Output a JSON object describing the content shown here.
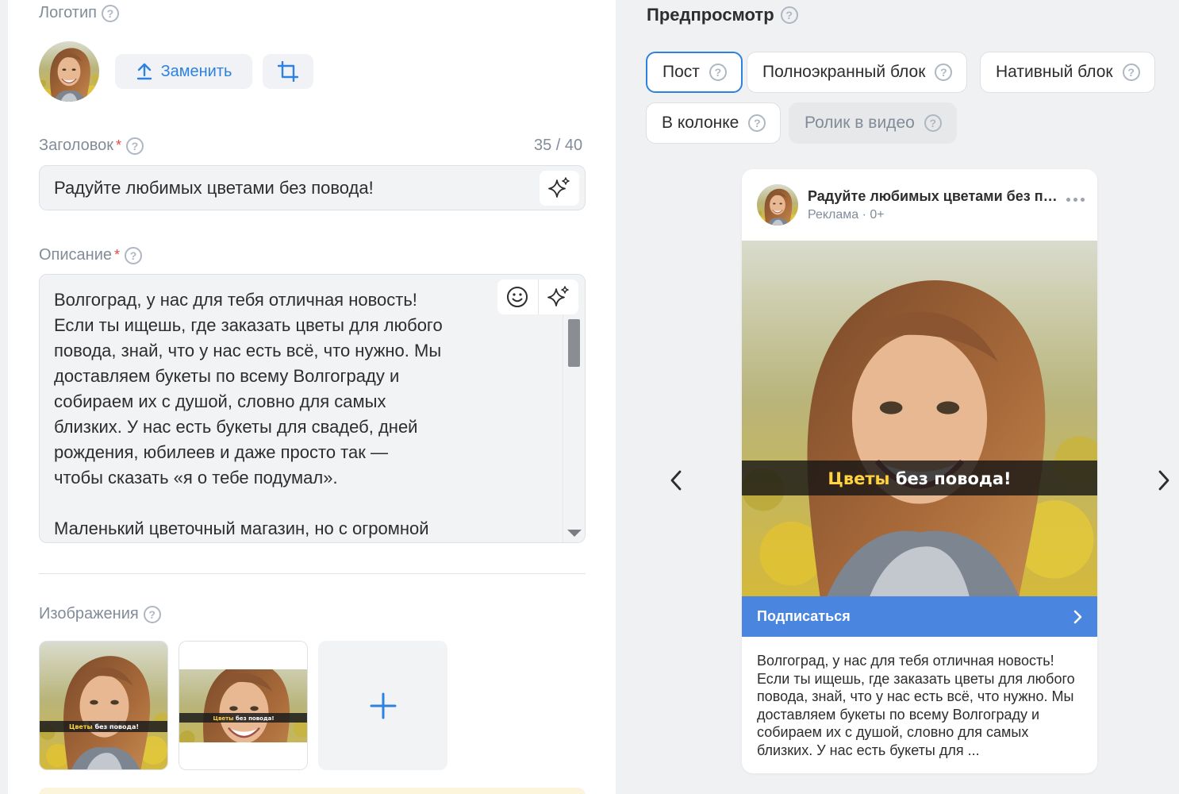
{
  "form": {
    "logo": {
      "label": "Логотип",
      "replace_label": "Заменить"
    },
    "title": {
      "label": "Заголовок",
      "required_mark": "*",
      "counter": "35 / 40",
      "value": "Радуйте любимых цветами без повода!"
    },
    "description": {
      "label": "Описание",
      "required_mark": "*",
      "value": "Волгоград, у нас для тебя отличная новость!\nЕсли ты ищешь, где заказать цветы для любого\nповода, знай, что у нас есть всё, что нужно. Мы\nдоставляем букеты по всему Волгограду и\nсобираем их с душой, словно для самых\nблизких. У нас есть букеты для свадеб, дней\nрождения, юбилеев и даже просто так —\nчтобы сказать «я о тебе подумал».\n\nМаленький цветочный магазин, но с огромной"
    },
    "images": {
      "label": "Изображения"
    }
  },
  "preview": {
    "title": "Предпросмотр",
    "formats": [
      {
        "label": "Пост",
        "state": "active"
      },
      {
        "label": "Полноэкранный блок",
        "state": "normal"
      },
      {
        "label": "Нативный блок",
        "state": "normal"
      },
      {
        "label": "В колонке",
        "state": "normal"
      },
      {
        "label": "Ролик в видео",
        "state": "disabled"
      }
    ],
    "card": {
      "title": "Радуйте любимых цветами без повода!",
      "meta": "Реклама · 0+",
      "banner_highlight": "Цветы",
      "banner_rest": " без повода!",
      "cta": "Подписаться",
      "text": "Волгоград, у нас для тебя отличная новость! Если ты ищешь, где заказать цветы для любого повода, знай, что у нас есть всё, что нужно. Мы доставляем букеты по всему Волгограду и собираем их с душой, словно для самых близких. У нас есть букеты для ..."
    }
  },
  "icons": {
    "help": "help-circle-icon",
    "upload": "upload-icon",
    "crop": "crop-icon",
    "ai": "sparkle-icon",
    "emoji": "emoji-icon",
    "plus": "plus-icon",
    "more": "more-dots-icon",
    "prev": "chevron-left-icon",
    "next": "chevron-right-icon"
  },
  "colors": {
    "accent": "#2d81e0",
    "cta": "#4a86e0",
    "required": "#e64646",
    "banner_highlight": "#ffd23f"
  }
}
